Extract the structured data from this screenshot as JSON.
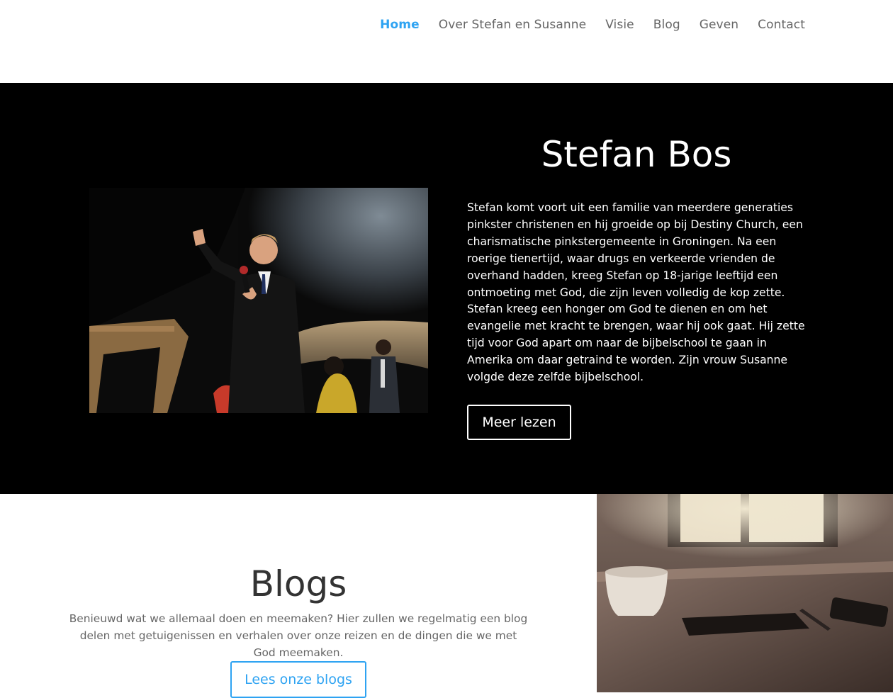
{
  "nav": {
    "items": [
      {
        "label": "Home",
        "active": true
      },
      {
        "label": "Over Stefan en Susanne",
        "active": false
      },
      {
        "label": "Visie",
        "active": false
      },
      {
        "label": "Blog",
        "active": false
      },
      {
        "label": "Geven",
        "active": false
      },
      {
        "label": "Contact",
        "active": false
      }
    ]
  },
  "hero": {
    "title": "Stefan Bos",
    "text": "Stefan komt voort uit een familie van meerdere generaties pinkster christenen en hij groeide op bij Destiny Church, een charismatische pinkstergemeente in Groningen. Na een roerige tienertijd, waar drugs en verkeerde vrienden de overhand hadden, kreeg Stefan op 18-jarige leeftijd een ontmoeting met God, die zijn leven volledig de kop zette. Stefan kreeg een honger om God te dienen en om het evangelie met kracht te brengen, waar hij ook gaat. Hij zette tijd voor God apart om naar de bijbelschool te gaan in Amerika om daar getraind te worden. Zijn vrouw Susanne volgde deze zelfde bijbelschool.",
    "button_label": "Meer lezen"
  },
  "blogs": {
    "title": "Blogs",
    "text": "Benieuwd wat we allemaal doen en meemaken? Hier zullen we regelmatig een blog delen met getuigenissen en verhalen over onze reizen en de dingen die we met God meemaken.",
    "button_label": "Lees onze blogs"
  },
  "colors": {
    "accent": "#2ea3f2",
    "nav_text": "#666666",
    "hero_bg": "#000000"
  }
}
